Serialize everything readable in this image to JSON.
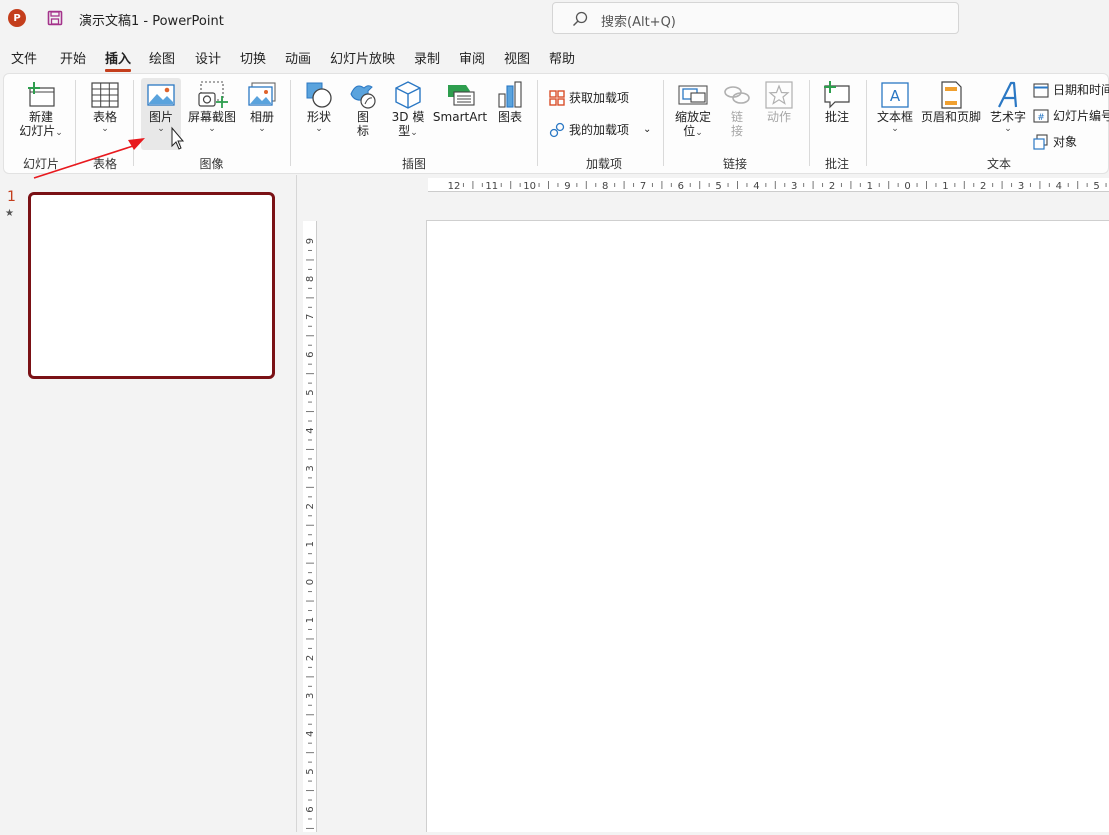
{
  "app": {
    "title": "演示文稿1  -  PowerPoint",
    "logo_letter": "P"
  },
  "search": {
    "text": "搜索(Alt+Q)"
  },
  "menu": [
    "文件",
    "开始",
    "插入",
    "绘图",
    "设计",
    "切换",
    "动画",
    "幻灯片放映",
    "录制",
    "审阅",
    "视图",
    "帮助"
  ],
  "menu_active": "插入",
  "ribbon": {
    "new_slide": "新建\n幻灯片",
    "table": "表格",
    "picture": "图片",
    "screenshot": "屏幕截图",
    "album": "相册",
    "shapes": "形状",
    "icons": "图\n标",
    "model3d": "3D 模\n型",
    "smartart": "SmartArt",
    "chart": "图表",
    "get_addins": "获取加载项",
    "my_addins": "我的加载项",
    "zoom": "缩放定\n位",
    "link": "链\n接",
    "action": "动作",
    "comment": "批注",
    "textbox": "文本框",
    "header_footer": "页眉和页脚",
    "wordart": "艺术字",
    "datetime": "日期和时间",
    "slide_number": "幻灯片编号",
    "object": "对象",
    "groups": {
      "slides": "幻灯片",
      "tables": "表格",
      "images": "图像",
      "illustrations": "插图",
      "addins": "加载项",
      "links": "链接",
      "comments": "批注",
      "text": "文本"
    }
  },
  "thumbnail": {
    "number": "1",
    "star": "★"
  },
  "rulers": {
    "horizontal": [
      "12",
      "11",
      "10",
      "9",
      "8",
      "7",
      "6",
      "5",
      "4",
      "3",
      "2",
      "1",
      "0",
      "1",
      "2",
      "3",
      "4",
      "5"
    ],
    "vertical": [
      "9",
      "8",
      "7",
      "6",
      "5",
      "4",
      "3",
      "2",
      "1",
      "0",
      "1",
      "2",
      "3",
      "4",
      "5",
      "6"
    ]
  },
  "colors": {
    "accent": "#c43e1c",
    "thumb_border": "#7a1115",
    "arrow": "#e8191e"
  }
}
